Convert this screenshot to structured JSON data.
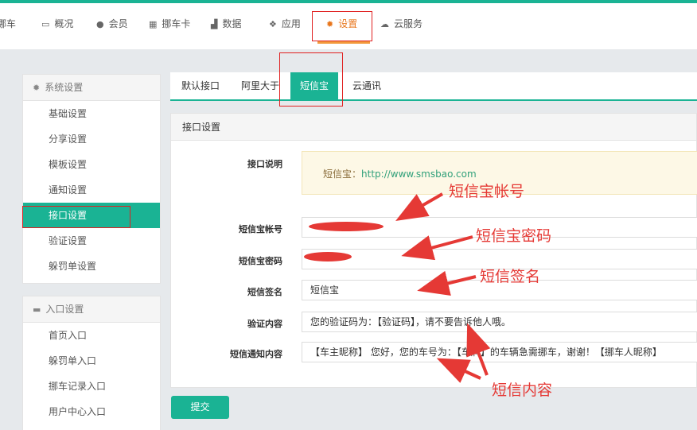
{
  "nav": [
    {
      "label": "挪车",
      "icon": "car-icon"
    },
    {
      "label": "概况",
      "icon": "monitor-icon"
    },
    {
      "label": "会员",
      "icon": "user-icon"
    },
    {
      "label": "挪车卡",
      "icon": "qrcode-icon"
    },
    {
      "label": "数据",
      "icon": "chart-icon"
    },
    {
      "label": "应用",
      "icon": "cubes-icon"
    },
    {
      "label": "设置",
      "icon": "gear-icon",
      "active": true
    },
    {
      "label": "云服务",
      "icon": "cloud-icon"
    }
  ],
  "sidebar": {
    "system": {
      "title": "系统设置",
      "items": [
        "基础设置",
        "分享设置",
        "模板设置",
        "通知设置",
        "接口设置",
        "验证设置",
        "躲罚单设置"
      ],
      "active_index": 4
    },
    "entry": {
      "title": "入口设置",
      "items": [
        "首页入口",
        "躲罚单入口",
        "挪车记录入口",
        "用户中心入口"
      ]
    }
  },
  "tabs": [
    "默认接口",
    "阿里大于",
    "短信宝",
    "云通讯"
  ],
  "active_tab": 2,
  "panel": {
    "title": "接口设置",
    "desc_label": "接口说明",
    "desc_prefix": "短信宝：",
    "desc_url": "http://www.smsbao.com",
    "fields": [
      {
        "label": "短信宝帐号",
        "value": ""
      },
      {
        "label": "短信宝密码",
        "value": ""
      },
      {
        "label": "短信签名",
        "value": "短信宝"
      },
      {
        "label": "验证内容",
        "value": "您的验证码为：【验证码】，请不要告诉他人哦。"
      },
      {
        "label": "短信通知内容",
        "value": "【车主昵称】 您好，您的车号为：【车牌】的车辆急需挪车，谢谢！【挪车人昵称】"
      }
    ],
    "submit": "提交"
  },
  "annotations": {
    "account": "短信宝帐号",
    "password": "短信宝密码",
    "signature": "短信签名",
    "content": "短信内容"
  },
  "colors": {
    "accent": "#1ab394",
    "active_nav": "#e8761c",
    "annotation": "#e53935"
  }
}
